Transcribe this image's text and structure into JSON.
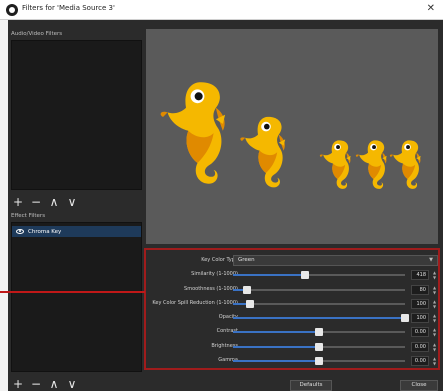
{
  "window": {
    "title": "Filters for 'Media Source 3'"
  },
  "panels": {
    "audio_video_label": "Audio/Video Filters",
    "effect_label": "Effect Filters"
  },
  "effect_filters": [
    {
      "name": "Chroma Key"
    }
  ],
  "toolbar": {
    "add": "+",
    "remove": "−",
    "up": "∧",
    "down": "∨"
  },
  "settings": {
    "key_color_type": {
      "label": "Key Color Type",
      "value": "Green"
    },
    "sliders": [
      {
        "label": "Similarity (1-1000)",
        "value": "418",
        "fraction": 0.42
      },
      {
        "label": "Smoothness (1-1000)",
        "value": "80",
        "fraction": 0.08
      },
      {
        "label": "Key Color Spill Reduction (1-1000)",
        "value": "100",
        "fraction": 0.1
      },
      {
        "label": "Opacity",
        "value": "100",
        "fraction": 1.0
      },
      {
        "label": "Contrast",
        "value": "0.00",
        "fraction": 0.5
      },
      {
        "label": "Brightness",
        "value": "0.00",
        "fraction": 0.5
      },
      {
        "label": "Gamma",
        "value": "0.00",
        "fraction": 0.5
      }
    ]
  },
  "buttons": {
    "defaults": "Defaults",
    "close": "Close"
  },
  "colors": {
    "accent": "#3a72c4",
    "highlight_border": "#a01c1c",
    "seahorse_body": "#f5b800",
    "seahorse_shade": "#e08a00"
  }
}
